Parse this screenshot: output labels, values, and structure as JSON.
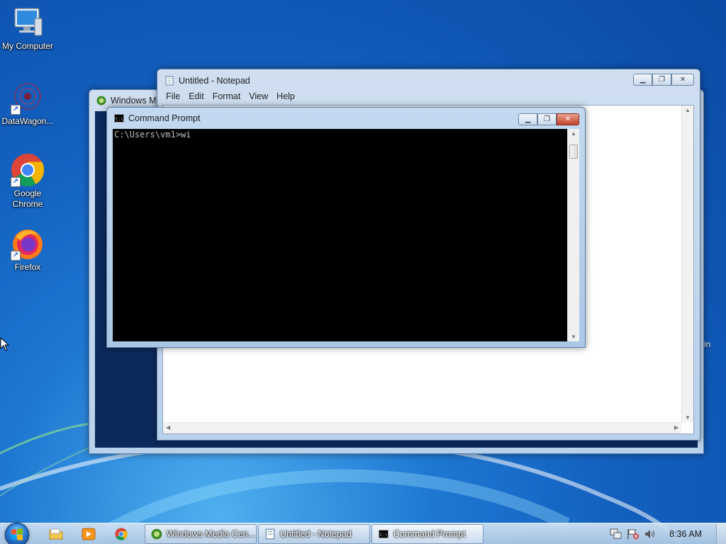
{
  "desktop": {
    "icons": [
      {
        "label": "My Computer",
        "icon": "computer-icon"
      },
      {
        "label": "DataWagon...",
        "icon": "datawagon-icon"
      },
      {
        "label": "Google Chrome",
        "icon": "chrome-icon"
      },
      {
        "label": "Firefox",
        "icon": "firefox-icon"
      }
    ],
    "partial_right_text": "in"
  },
  "windows": {
    "media_center": {
      "title": "Windows Me"
    },
    "notepad": {
      "title": "Untitled - Notepad",
      "menu": [
        "File",
        "Edit",
        "Format",
        "View",
        "Help"
      ],
      "content": ""
    },
    "cmd": {
      "title": "Command Prompt",
      "output": "C:\\Users\\vm1>wi"
    }
  },
  "taskbar": {
    "buttons": [
      {
        "label": "Windows Media Cen...",
        "icon": "media-center-icon"
      },
      {
        "label": "Untitled - Notepad",
        "icon": "notepad-icon"
      },
      {
        "label": "Command Prompt",
        "icon": "cmd-icon"
      }
    ],
    "pinned": [
      "explorer-icon",
      "media-player-icon",
      "chrome-icon"
    ],
    "clock": "8:36 AM"
  },
  "colors": {
    "desktop_blue": "#1360bf",
    "window_frame": "#b9d1ea",
    "console_bg": "#000000",
    "close_red": "#c3432a"
  }
}
